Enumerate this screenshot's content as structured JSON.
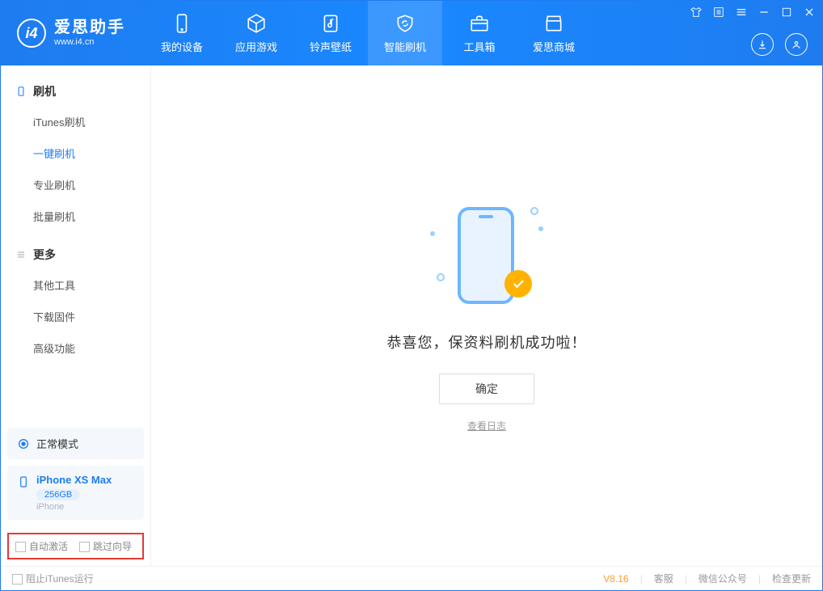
{
  "app": {
    "name_cn": "爱思助手",
    "name_en": "www.i4.cn"
  },
  "nav": {
    "items": [
      {
        "label": "我的设备"
      },
      {
        "label": "应用游戏"
      },
      {
        "label": "铃声壁纸"
      },
      {
        "label": "智能刷机"
      },
      {
        "label": "工具箱"
      },
      {
        "label": "爱思商城"
      }
    ],
    "active_index": 3
  },
  "sidebar": {
    "groups": [
      {
        "title": "刷机",
        "items": [
          {
            "label": "iTunes刷机"
          },
          {
            "label": "一键刷机"
          },
          {
            "label": "专业刷机"
          },
          {
            "label": "批量刷机"
          }
        ],
        "active_index": 1
      },
      {
        "title": "更多",
        "items": [
          {
            "label": "其他工具"
          },
          {
            "label": "下载固件"
          },
          {
            "label": "高级功能"
          }
        ]
      }
    ],
    "mode_card": {
      "label": "正常模式"
    },
    "device_card": {
      "name": "iPhone XS Max",
      "capacity": "256GB",
      "type": "iPhone"
    },
    "options": {
      "auto_activate": "自动激活",
      "skip_guide": "跳过向导"
    }
  },
  "main": {
    "success_msg": "恭喜您，保资料刷机成功啦！",
    "ok_label": "确定",
    "log_link": "查看日志"
  },
  "footer": {
    "block_itunes": "阻止iTunes运行",
    "version": "V8.16",
    "links": {
      "service": "客服",
      "wechat": "微信公众号",
      "update": "检查更新"
    }
  }
}
